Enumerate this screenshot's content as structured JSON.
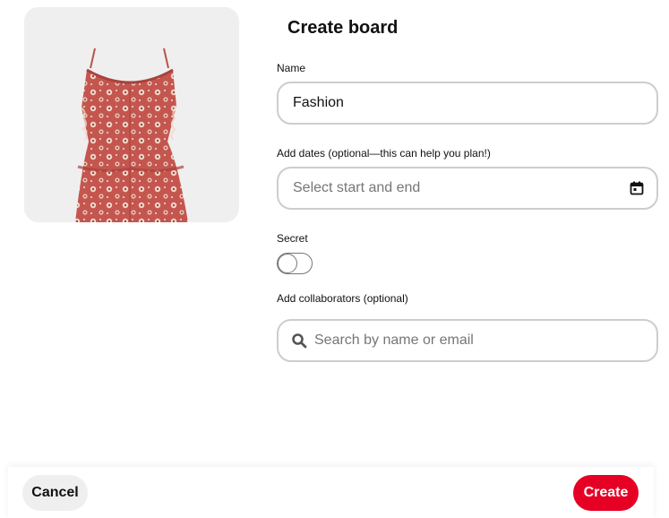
{
  "header": {
    "title": "Create board"
  },
  "pin_preview": {
    "alt": "Red floral ruffled dress"
  },
  "name_field": {
    "label": "Name",
    "value": "Fashion"
  },
  "dates_field": {
    "label": "Add dates (optional—this can help you plan!)",
    "placeholder": "Select start and end",
    "icon": "calendar-icon"
  },
  "secret_field": {
    "label": "Secret",
    "enabled": false
  },
  "collaborators_field": {
    "label": "Add collaborators (optional)",
    "placeholder": "Search by name or email",
    "icon": "search-icon"
  },
  "footer": {
    "cancel_label": "Cancel",
    "create_label": "Create"
  },
  "colors": {
    "accent": "#e60023",
    "border": "#cdcdcd",
    "secondary_button": "#efefef"
  }
}
